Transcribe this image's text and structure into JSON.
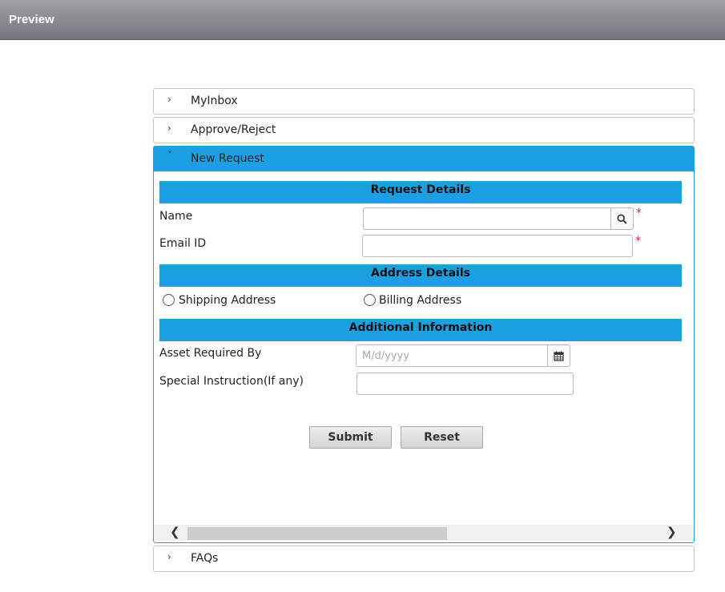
{
  "window": {
    "title": "Preview"
  },
  "accordion": {
    "items": [
      {
        "label": "MyInbox",
        "chevron": "›"
      },
      {
        "label": "Approve/Reject",
        "chevron": "›"
      },
      {
        "label": "New Request",
        "chevron": "˅"
      },
      {
        "label": "FAQs",
        "chevron": "›"
      }
    ]
  },
  "form": {
    "sections": {
      "request_details": "Request Details",
      "address_details": "Address Details",
      "additional_info": "Additional Information"
    },
    "name": {
      "label": "Name",
      "value": "",
      "placeholder": "",
      "required_mark": "*"
    },
    "email": {
      "label": "Email ID",
      "value": "",
      "placeholder": "",
      "required_mark": "*"
    },
    "address": {
      "options": [
        {
          "label": "Shipping Address",
          "selected": false
        },
        {
          "label": "Billing Address",
          "selected": false
        }
      ]
    },
    "asset_required_by": {
      "label": "Asset Required By",
      "value": "",
      "placeholder": "M/d/yyyy"
    },
    "special_instruction": {
      "label": "Special Instruction(If any)",
      "value": "",
      "placeholder": ""
    },
    "buttons": {
      "submit": "Submit",
      "reset": "Reset"
    }
  },
  "scrollbar": {
    "left_arrow": "❮",
    "right_arrow": "❯"
  },
  "icons": {
    "search": "search-icon",
    "calendar": "calendar-icon"
  },
  "colors": {
    "accent": "#1ba1e2",
    "required": "#d9262b",
    "topbar": "#8a8e93"
  }
}
